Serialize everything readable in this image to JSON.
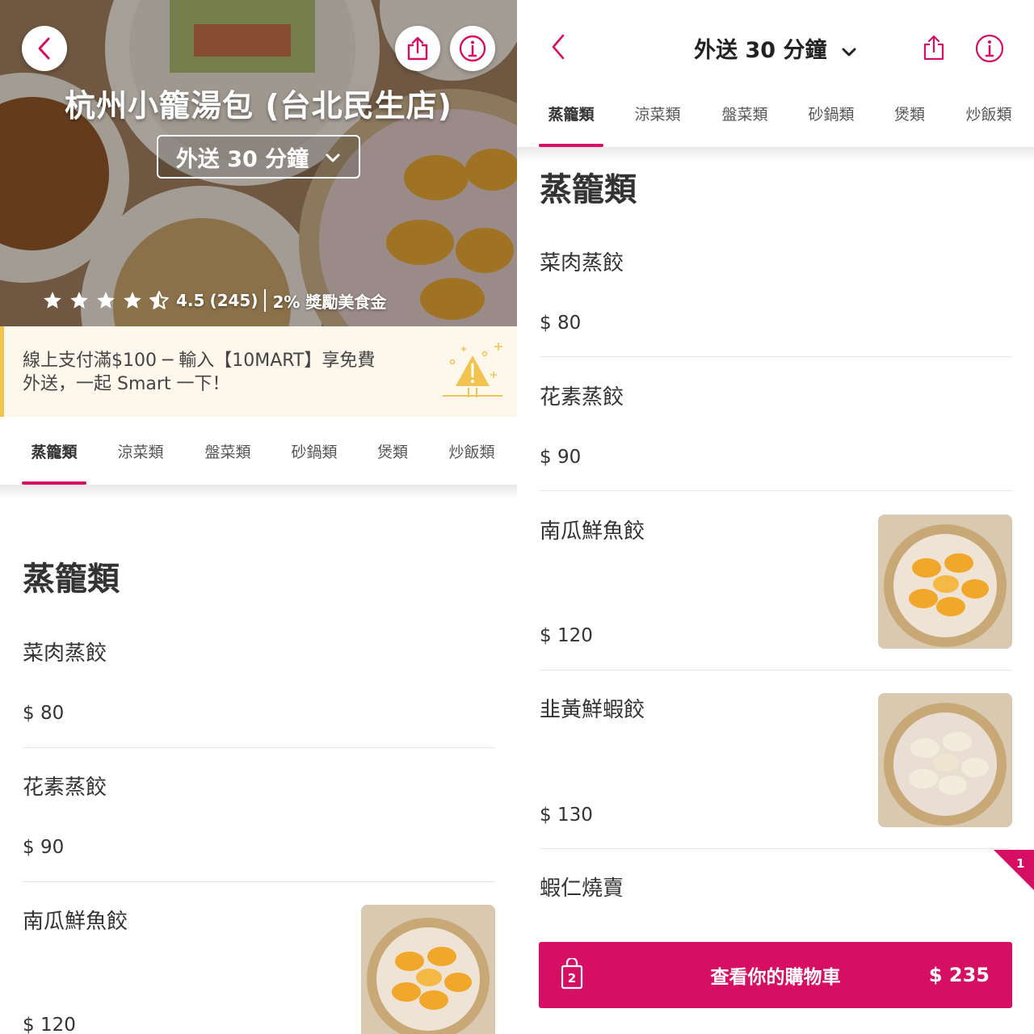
{
  "restaurant": {
    "name": "杭州小籠湯包 (台北民生店)",
    "rating": "4.5",
    "review_count": "(245)",
    "rating_stars": 4.5,
    "reward": "2% 獎勵美食金"
  },
  "delivery": {
    "label": "外送 30 分鐘"
  },
  "promo": {
    "line1": "線上支付滿$100 ─ 輸入【10MART】享免費",
    "line2": "外送，一起 Smart 一下！"
  },
  "tabs": [
    "蒸籠類",
    "涼菜類",
    "盤菜類",
    "砂鍋類",
    "煲類",
    "炒飯類"
  ],
  "section": {
    "title": "蒸籠類"
  },
  "items": [
    {
      "name": "菜肉蒸餃",
      "price": "$ 80"
    },
    {
      "name": "花素蒸餃",
      "price": "$ 90"
    },
    {
      "name": "南瓜鮮魚餃",
      "price": "$ 120"
    },
    {
      "name": "韭黃鮮蝦餃",
      "price": "$ 130"
    },
    {
      "name": "蝦仁燒賣"
    }
  ],
  "cart": {
    "label": "查看你的購物車",
    "total": "$ 235",
    "item_count": "2",
    "badge": "1"
  },
  "colors": {
    "brand": "#d70f64",
    "promo_bg": "#fdf7ec",
    "promo_accent": "#f3c34f"
  },
  "icons": {
    "back": "chevron-left-icon",
    "share": "share-icon",
    "info": "info-icon",
    "dropdown": "chevron-down-icon",
    "star": "star-icon",
    "cart": "shopping-bag-icon",
    "promo": "warning-sparkle-icon"
  }
}
